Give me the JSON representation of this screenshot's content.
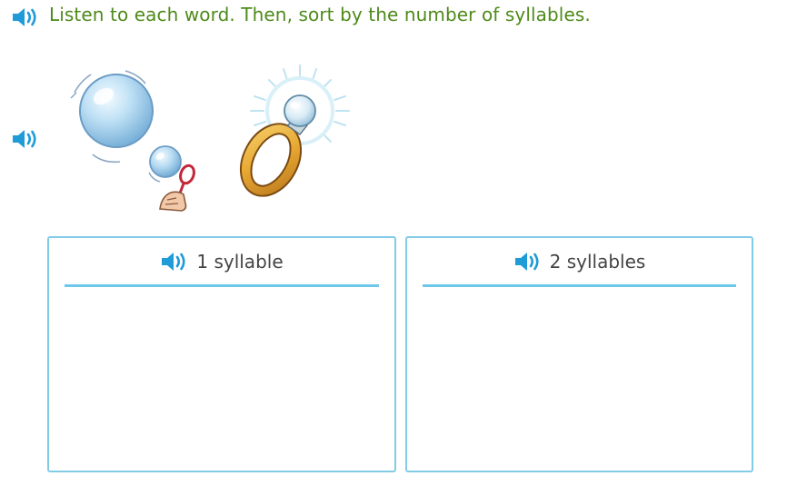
{
  "instruction": {
    "text": "Listen to each word. Then, sort by the number of syllables.",
    "speaker_icon": "speaker-icon"
  },
  "word_bank": {
    "speaker_icon": "speaker-icon",
    "items": [
      {
        "picture": "soap-bubbles",
        "icon": "bubbles-icon"
      },
      {
        "picture": "ring",
        "icon": "ring-icon"
      }
    ]
  },
  "sort_boxes": [
    {
      "label": "1 syllable",
      "speaker_icon": "speaker-icon"
    },
    {
      "label": "2 syllables",
      "speaker_icon": "speaker-icon"
    }
  ],
  "colors": {
    "instruction_text": "#4e8a1a",
    "speaker": "#1f9bd8",
    "box_border": "#82cce6",
    "box_rule": "#6ec8ec",
    "header_text": "#444444"
  }
}
